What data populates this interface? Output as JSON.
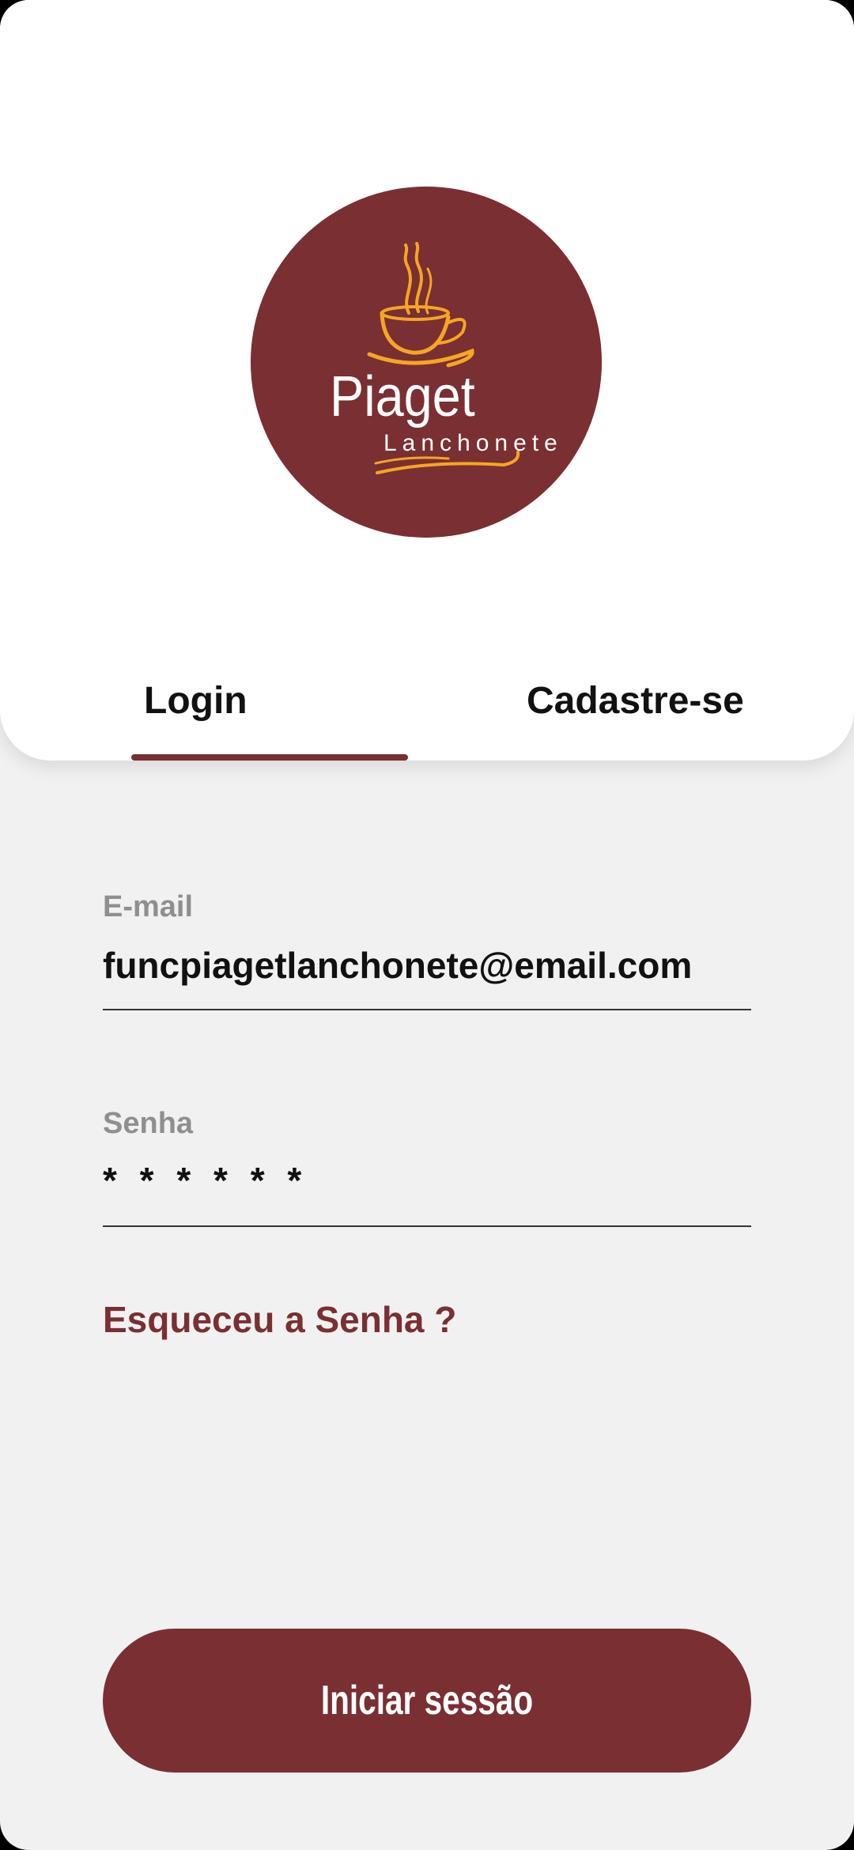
{
  "logo": {
    "name": "Piaget",
    "subtitle": "Lanchonete",
    "colors": {
      "background": "#7a2f32",
      "accent": "#f5a623",
      "text": "#ffffff"
    }
  },
  "tabs": [
    {
      "label": "Login",
      "active": true
    },
    {
      "label": "Cadastre-se",
      "active": false
    }
  ],
  "form": {
    "email": {
      "label": "E-mail",
      "value": "funcpiagetlanchonete@email.com"
    },
    "password": {
      "label": "Senha",
      "value": "* * * * * *"
    },
    "forgot_label": "Esqueceu a Senha ?",
    "submit_label": "Iniciar sessão"
  },
  "colors": {
    "brand": "#7a2f32",
    "background": "#f1f1f1",
    "card": "#ffffff"
  }
}
